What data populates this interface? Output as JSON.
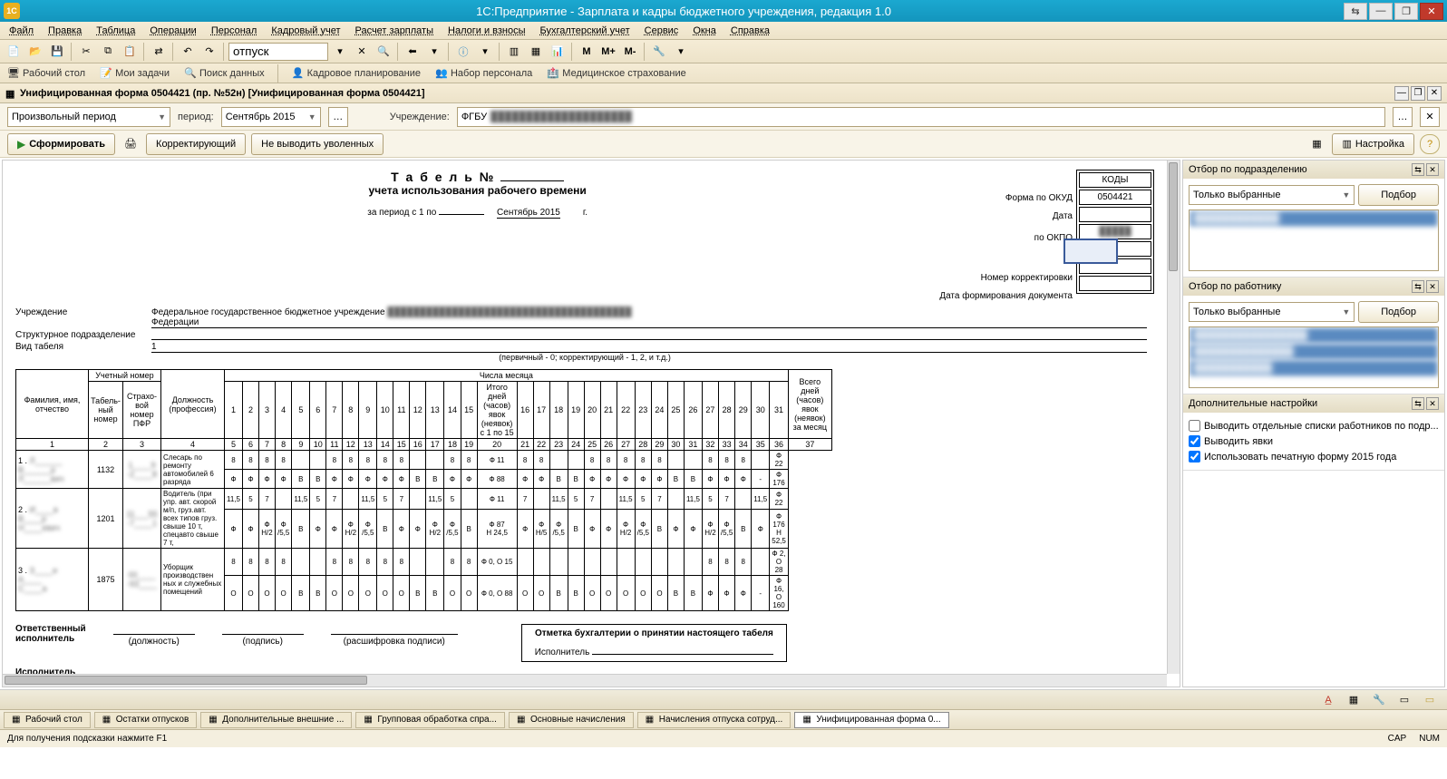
{
  "window": {
    "title": "1С:Предприятие - Зарплата и кадры бюджетного учреждения, редакция 1.0"
  },
  "menu": [
    "Файл",
    "Правка",
    "Таблица",
    "Операции",
    "Персонал",
    "Кадровый учет",
    "Расчет зарплаты",
    "Налоги и взносы",
    "Бухгалтерский учет",
    "Сервис",
    "Окна",
    "Справка"
  ],
  "toolbar": {
    "search_value": "отпуск",
    "m": "M",
    "mplus": "M+",
    "mminus": "M-"
  },
  "nav": {
    "desktop": "Рабочий стол",
    "tasks": "Мои задачи",
    "search": "Поиск данных",
    "planning": "Кадровое планирование",
    "recruit": "Набор персонала",
    "med": "Медицинское страхование"
  },
  "doctab": {
    "title": "Унифицированная форма 0504421 (пр. №52н) [Унифицированная форма 0504421]"
  },
  "filters": {
    "period_type": "Произвольный период",
    "period_lbl": "период:",
    "period_val": "Сентябрь 2015",
    "org_lbl": "Учреждение:",
    "org_val": "ФГБУ"
  },
  "actions": {
    "generate": "Сформировать",
    "correcting": "Корректирующий",
    "nodismissed": "Не выводить уволенных",
    "settings": "Настройка"
  },
  "form": {
    "title": "Т а б е л ь №",
    "subtitle": "учета использования рабочего времени",
    "period_line": "за период с 1 по",
    "period_date": "Сентябрь 2015",
    "period_year": "г.",
    "org_row": "Федеральное государственное бюджетное учреждение",
    "org_row2": "Федерации",
    "uchr_lbl": "Учреждение",
    "dept_lbl": "Структурное подразделение",
    "kind_lbl": "Вид табеля",
    "kind_val": "1",
    "primary_note": "(первичный - 0; корректирующий - 1, 2, и т.д.)",
    "kody": "КОДЫ",
    "okud_lbl": "Форма по ОКУД",
    "okud_val": "0504421",
    "date_lbl": "Дата",
    "okpo_lbl": "по ОКПО",
    "corr_lbl": "Номер корректировки",
    "docdate_lbl": "Дата формирования документа",
    "col_headers": {
      "fio": "Фамилия, имя, отчество",
      "acct": "Учетный номер",
      "tabno": "Табель-ный номер",
      "pfr": "Страхо-вой номер ПФР",
      "pos": "Должность (профессия)",
      "days": "Числа месяца",
      "mid": "Итого дней (часов) явок (неявок) с 1 по 15",
      "total": "Всего дней (часов) явок (неявок) за месяц"
    },
    "day_nums_a": [
      "1",
      "2",
      "3",
      "4",
      "5",
      "6",
      "7",
      "8",
      "9",
      "10",
      "11",
      "12",
      "13",
      "14",
      "15"
    ],
    "day_nums_b": [
      "16",
      "17",
      "18",
      "19",
      "20",
      "21",
      "22",
      "23",
      "24",
      "25",
      "26",
      "27",
      "28",
      "29",
      "30",
      "31"
    ],
    "col_nums": [
      "1",
      "2",
      "3",
      "4",
      "5",
      "6",
      "7",
      "8",
      "9",
      "10",
      "11",
      "12",
      "13",
      "14",
      "15",
      "16",
      "17",
      "18",
      "19",
      "20",
      "21",
      "22",
      "23",
      "24",
      "25",
      "26",
      "27",
      "28",
      "29",
      "30",
      "31",
      "32",
      "33",
      "34",
      "35",
      "36",
      "37"
    ],
    "rows": [
      {
        "n": "1 .",
        "fio": "Л______\nВ______р\nЛ______вич",
        "tab": "1132",
        "pfr": "1____9\n-2____8",
        "pos": "Слесарь по ремонту автомобилей 6 разряда",
        "r1": [
          "8",
          "8",
          "8",
          "8",
          "",
          "",
          "8",
          "8",
          "8",
          "8",
          "8",
          "",
          "",
          "8",
          "8",
          "Ф 11",
          "8",
          "8",
          "",
          "",
          "8",
          "8",
          "8",
          "8",
          "8",
          "",
          "",
          "8",
          "8",
          "8",
          "",
          "Ф 22"
        ],
        "r2": [
          "Ф",
          "Ф",
          "Ф",
          "Ф",
          "В",
          "В",
          "Ф",
          "Ф",
          "Ф",
          "Ф",
          "Ф",
          "В",
          "В",
          "Ф",
          "Ф",
          "Ф 88",
          "Ф",
          "Ф",
          "В",
          "В",
          "Ф",
          "Ф",
          "Ф",
          "Ф",
          "Ф",
          "В",
          "В",
          "Ф",
          "Ф",
          "Ф",
          "-",
          "Ф 176"
        ]
      },
      {
        "n": "2 .",
        "fio": "И____в\nВ____р\nН____евич",
        "tab": "1201",
        "pfr": "11___55\n-7____1",
        "pos": "Водитель (при упр. авт. скорой м/п, груз.авт. всех типов груз. свыше 10 т, спецавто свыше 7 т,",
        "r1": [
          "11,5",
          "5",
          "7",
          "",
          "11,5",
          "5",
          "7",
          "",
          "11,5",
          "5",
          "7",
          "",
          "11,5",
          "5",
          "",
          "Ф 11",
          "7",
          "",
          "11,5",
          "5",
          "7",
          "",
          "11,5",
          "5",
          "7",
          "",
          "11,5",
          "5",
          "7",
          "",
          "11,5",
          "Ф 22"
        ],
        "r2": [
          "Ф",
          "Ф",
          "Ф Н/2",
          "Ф /5,5",
          "В",
          "Ф",
          "Ф",
          "Ф Н/2",
          "Ф /5,5",
          "В",
          "Ф",
          "Ф",
          "Ф Н/2",
          "Ф /5,5",
          "В",
          "Ф 87\nН 24,5",
          "Ф",
          "Ф Н/5",
          "Ф /5,5",
          "В",
          "Ф",
          "Ф",
          "Ф Н/2",
          "Ф /5,5",
          "В",
          "Ф",
          "Ф",
          "Ф Н/2",
          "Ф /5,5",
          "В",
          "Ф",
          "Ф 176\nН 52,5"
        ]
      },
      {
        "n": "3 .",
        "fio": "З____и\nА____\nС____а",
        "tab": "1875",
        "pfr": "00____\n-93____",
        "pos": "Уборщик производствен ных и служебных помещений",
        "r1": [
          "8",
          "8",
          "8",
          "8",
          "",
          "",
          "8",
          "8",
          "8",
          "8",
          "8",
          "",
          "",
          "8",
          "8",
          "Ф 0, О 15",
          "",
          "",
          "",
          "",
          "",
          "",
          "",
          "",
          "",
          "",
          "",
          "8",
          "8",
          "8",
          "",
          "Ф 2, О 28"
        ],
        "r2": [
          "О",
          "О",
          "О",
          "О",
          "В",
          "В",
          "О",
          "О",
          "О",
          "О",
          "О",
          "В",
          "В",
          "О",
          "О",
          "Ф 0, О 88",
          "О",
          "О",
          "В",
          "В",
          "О",
          "О",
          "О",
          "О",
          "О",
          "В",
          "В",
          "Ф",
          "Ф",
          "Ф",
          "-",
          "Ф 16, О 160"
        ]
      }
    ],
    "resp_lbl": "Ответственный\nисполнитель",
    "exec_lbl": "Исполнитель",
    "sig_pos": "(должность)",
    "sig_sign": "(подпись)",
    "sig_name": "(расшифровка подписи)",
    "buh_title": "Отметка бухгалтерии о принятии настоящего табеля",
    "buh_exec": "Исполнитель"
  },
  "side": {
    "sec1": "Отбор по подразделению",
    "sec2": "Отбор по работнику",
    "sec3": "Дополнительные настройки",
    "mode": "Только выбранные",
    "pick": "Подбор",
    "chk1": "Выводить отдельные списки работников по подр...",
    "chk2": "Выводить явки",
    "chk3": "Использовать печатную форму 2015 года"
  },
  "tasktabs": [
    {
      "label": "Рабочий стол",
      "active": false
    },
    {
      "label": "Остатки отпусков",
      "active": false
    },
    {
      "label": "Дополнительные внешние ...",
      "active": false
    },
    {
      "label": "Групповая обработка спра...",
      "active": false
    },
    {
      "label": "Основные начисления",
      "active": false
    },
    {
      "label": "Начисления отпуска сотруд...",
      "active": false
    },
    {
      "label": "Унифицированная форма 0...",
      "active": true
    }
  ],
  "status": {
    "hint": "Для получения подсказки нажмите F1",
    "cap": "CAP",
    "num": "NUM"
  }
}
